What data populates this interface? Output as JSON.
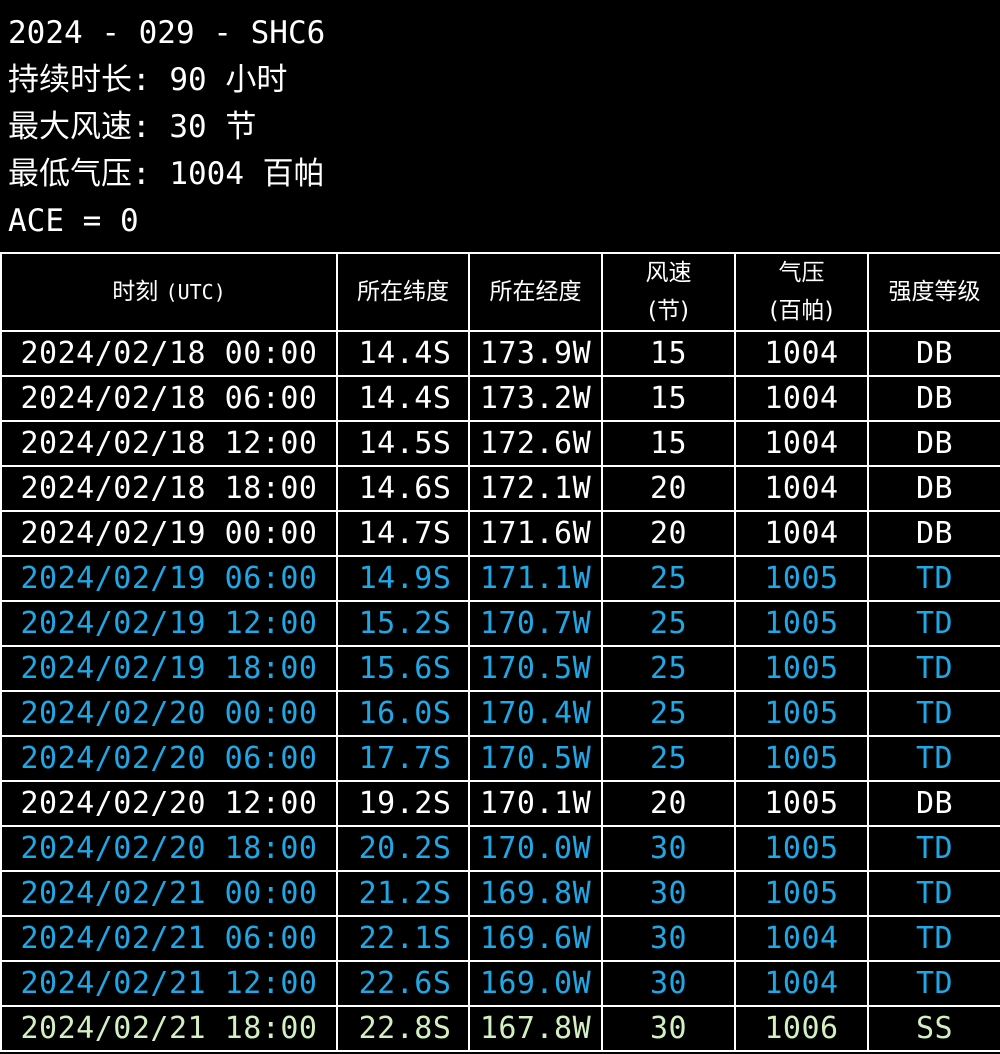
{
  "storm": {
    "title_line": "2024 - 029 - SHC6",
    "duration_line": "持续时长: 90 小时",
    "max_wind_line": "最大风速: 30 节",
    "min_pressure_line": "最低气压: 1004 百帕",
    "ace_line": "ACE = 0"
  },
  "table": {
    "headers": {
      "time_label": "时刻",
      "time_unit": "(UTC)",
      "lat": "所在纬度",
      "lon": "所在经度",
      "wind_label": "风速",
      "wind_unit": "(节)",
      "pressure_label": "气压",
      "pressure_unit": "(百帕)",
      "class": "强度等级"
    },
    "rows": [
      {
        "time": "2024/02/18 00:00",
        "lat": "14.4S",
        "lon": "173.9W",
        "wind": "15",
        "pressure": "1004",
        "class": "DB"
      },
      {
        "time": "2024/02/18 06:00",
        "lat": "14.4S",
        "lon": "173.2W",
        "wind": "15",
        "pressure": "1004",
        "class": "DB"
      },
      {
        "time": "2024/02/18 12:00",
        "lat": "14.5S",
        "lon": "172.6W",
        "wind": "15",
        "pressure": "1004",
        "class": "DB"
      },
      {
        "time": "2024/02/18 18:00",
        "lat": "14.6S",
        "lon": "172.1W",
        "wind": "20",
        "pressure": "1004",
        "class": "DB"
      },
      {
        "time": "2024/02/19 00:00",
        "lat": "14.7S",
        "lon": "171.6W",
        "wind": "20",
        "pressure": "1004",
        "class": "DB"
      },
      {
        "time": "2024/02/19 06:00",
        "lat": "14.9S",
        "lon": "171.1W",
        "wind": "25",
        "pressure": "1005",
        "class": "TD"
      },
      {
        "time": "2024/02/19 12:00",
        "lat": "15.2S",
        "lon": "170.7W",
        "wind": "25",
        "pressure": "1005",
        "class": "TD"
      },
      {
        "time": "2024/02/19 18:00",
        "lat": "15.6S",
        "lon": "170.5W",
        "wind": "25",
        "pressure": "1005",
        "class": "TD"
      },
      {
        "time": "2024/02/20 00:00",
        "lat": "16.0S",
        "lon": "170.4W",
        "wind": "25",
        "pressure": "1005",
        "class": "TD"
      },
      {
        "time": "2024/02/20 06:00",
        "lat": "17.7S",
        "lon": "170.5W",
        "wind": "25",
        "pressure": "1005",
        "class": "TD"
      },
      {
        "time": "2024/02/20 12:00",
        "lat": "19.2S",
        "lon": "170.1W",
        "wind": "20",
        "pressure": "1005",
        "class": "DB"
      },
      {
        "time": "2024/02/20 18:00",
        "lat": "20.2S",
        "lon": "170.0W",
        "wind": "30",
        "pressure": "1005",
        "class": "TD"
      },
      {
        "time": "2024/02/21 00:00",
        "lat": "21.2S",
        "lon": "169.8W",
        "wind": "30",
        "pressure": "1005",
        "class": "TD"
      },
      {
        "time": "2024/02/21 06:00",
        "lat": "22.1S",
        "lon": "169.6W",
        "wind": "30",
        "pressure": "1004",
        "class": "TD"
      },
      {
        "time": "2024/02/21 12:00",
        "lat": "22.6S",
        "lon": "169.0W",
        "wind": "30",
        "pressure": "1004",
        "class": "TD"
      },
      {
        "time": "2024/02/21 18:00",
        "lat": "22.8S",
        "lon": "167.8W",
        "wind": "30",
        "pressure": "1006",
        "class": "SS"
      }
    ]
  },
  "colors": {
    "background": "#000000",
    "text_DB": "#ffffff",
    "text_TD": "#1ea8e6",
    "text_SS": "#d2f0c0",
    "border": "#ffffff"
  }
}
